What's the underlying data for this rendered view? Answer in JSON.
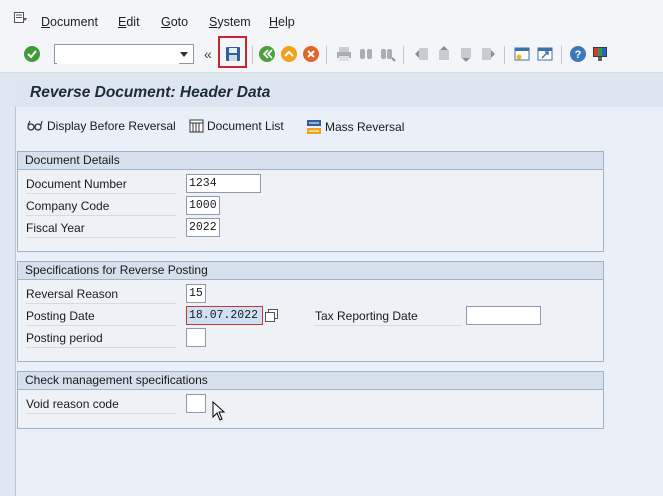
{
  "menubar": {
    "items": [
      {
        "label": "Document",
        "mnemonic": "D"
      },
      {
        "label": "Edit",
        "mnemonic": "E"
      },
      {
        "label": "Goto",
        "mnemonic": "G"
      },
      {
        "label": "System",
        "mnemonic": "S"
      },
      {
        "label": "Help",
        "mnemonic": "H"
      }
    ]
  },
  "toolbar": {
    "command_field_value": "",
    "icons": [
      "enter-check-icon",
      "save-icon",
      "back-icon",
      "exit-icon",
      "cancel-icon",
      "print-icon",
      "find-icon",
      "find-next-icon",
      "first-page-icon",
      "previous-page-icon",
      "next-page-icon",
      "last-page-icon",
      "create-session-icon",
      "shortcut-icon",
      "help-icon",
      "customize-layout-icon"
    ]
  },
  "page": {
    "title": "Reverse Document: Header Data"
  },
  "app_toolbar": {
    "display_before_reversal": "Display Before Reversal",
    "document_list": "Document List",
    "mass_reversal": "Mass Reversal"
  },
  "document_details": {
    "heading": "Document Details",
    "document_number_label": "Document Number",
    "document_number_value": "1234",
    "company_code_label": "Company Code",
    "company_code_value": "1000",
    "fiscal_year_label": "Fiscal Year",
    "fiscal_year_value": "2022"
  },
  "reverse_posting": {
    "heading": "Specifications for Reverse Posting",
    "reversal_reason_label": "Reversal Reason",
    "reversal_reason_value": "15",
    "posting_date_label": "Posting Date",
    "posting_date_value": "18.07.2022",
    "tax_reporting_date_label": "Tax Reporting Date",
    "tax_reporting_date_value": "",
    "posting_period_label": "Posting period",
    "posting_period_value": ""
  },
  "check_management": {
    "heading": "Check management specifications",
    "void_reason_code_label": "Void reason code",
    "void_reason_code_value": ""
  },
  "colors": {
    "highlight_border": "#c8262e",
    "background": "#dfe8f1"
  }
}
